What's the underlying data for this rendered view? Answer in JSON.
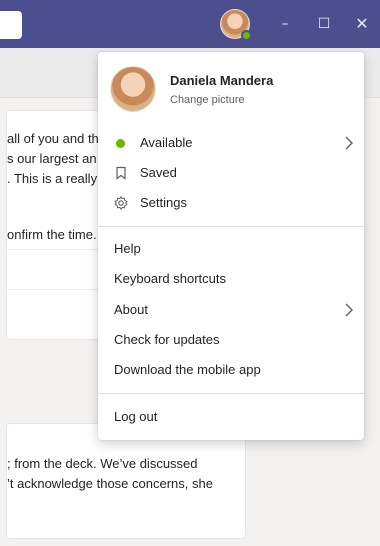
{
  "profile": {
    "name": "Daniela Mandera",
    "change_picture": "Change picture",
    "status_color": "#6bb700"
  },
  "menu": {
    "status": {
      "label": "Available",
      "icon": "available-status-icon",
      "has_submenu": true
    },
    "saved": {
      "label": "Saved",
      "icon": "bookmark-icon"
    },
    "settings": {
      "label": "Settings",
      "icon": "gear-icon"
    },
    "help": {
      "label": "Help"
    },
    "keyboard_shortcuts": {
      "label": "Keyboard shortcuts"
    },
    "about": {
      "label": "About",
      "has_submenu": true
    },
    "check_updates": {
      "label": "Check for updates"
    },
    "download_mobile": {
      "label": "Download the mobile app"
    },
    "log_out": {
      "label": "Log out"
    }
  },
  "background": {
    "message1": {
      "lines": [
        "all of you and th",
        "s our largest an",
        ". This is a really i",
        "onfirm the time."
      ]
    },
    "message2": {
      "lines": [
        "; from the deck. We’ve discussed",
        "’t acknowledge those concerns, she"
      ]
    }
  },
  "window_controls": {
    "minimize": "–",
    "maximize": "☐",
    "close": "✕"
  },
  "colors": {
    "title_bar": "#4c4f8e",
    "accent_available": "#6bb700"
  }
}
